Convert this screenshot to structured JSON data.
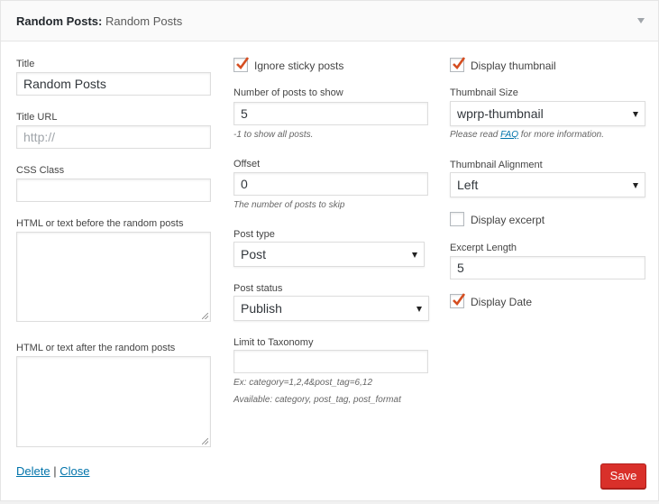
{
  "header": {
    "widget_name": "Random Posts:",
    "in_title": "Random Posts"
  },
  "col1": {
    "title_label": "Title",
    "title_value": "Random Posts",
    "title_url_label": "Title URL",
    "title_url_placeholder": "http://",
    "css_class_label": "CSS Class",
    "css_class_value": "",
    "before_label": "HTML or text before the random posts",
    "after_label": "HTML or text after the random posts"
  },
  "col2": {
    "ignore_sticky_label": "Ignore sticky posts",
    "ignore_sticky_checked": true,
    "num_posts_label": "Number of posts to show",
    "num_posts_value": "5",
    "num_posts_help": "-1 to show all posts.",
    "offset_label": "Offset",
    "offset_value": "0",
    "offset_help": "The number of posts to skip",
    "post_type_label": "Post type",
    "post_type_value": "Post",
    "post_status_label": "Post status",
    "post_status_value": "Publish",
    "taxonomy_label": "Limit to Taxonomy",
    "taxonomy_value": "",
    "taxonomy_help_1": "Ex: category=1,2,4&post_tag=6,12",
    "taxonomy_help_2": "Available: category, post_tag, post_format"
  },
  "col3": {
    "display_thumb_label": "Display thumbnail",
    "display_thumb_checked": true,
    "thumb_size_label": "Thumbnail Size",
    "thumb_size_value": "wprp-thumbnail",
    "thumb_help_pre": "Please read ",
    "thumb_help_link": "FAQ",
    "thumb_help_post": " for more information.",
    "thumb_align_label": "Thumbnail Alignment",
    "thumb_align_value": "Left",
    "display_excerpt_label": "Display excerpt",
    "display_excerpt_checked": false,
    "excerpt_length_label": "Excerpt Length",
    "excerpt_length_value": "5",
    "display_date_label": "Display Date",
    "display_date_checked": true
  },
  "footer": {
    "delete_label": "Delete",
    "separator": "|",
    "close_label": "Close",
    "save_label": "Save"
  },
  "colors": {
    "check": "#d54e21",
    "save_button": "#d9302a",
    "link": "#0073aa"
  }
}
